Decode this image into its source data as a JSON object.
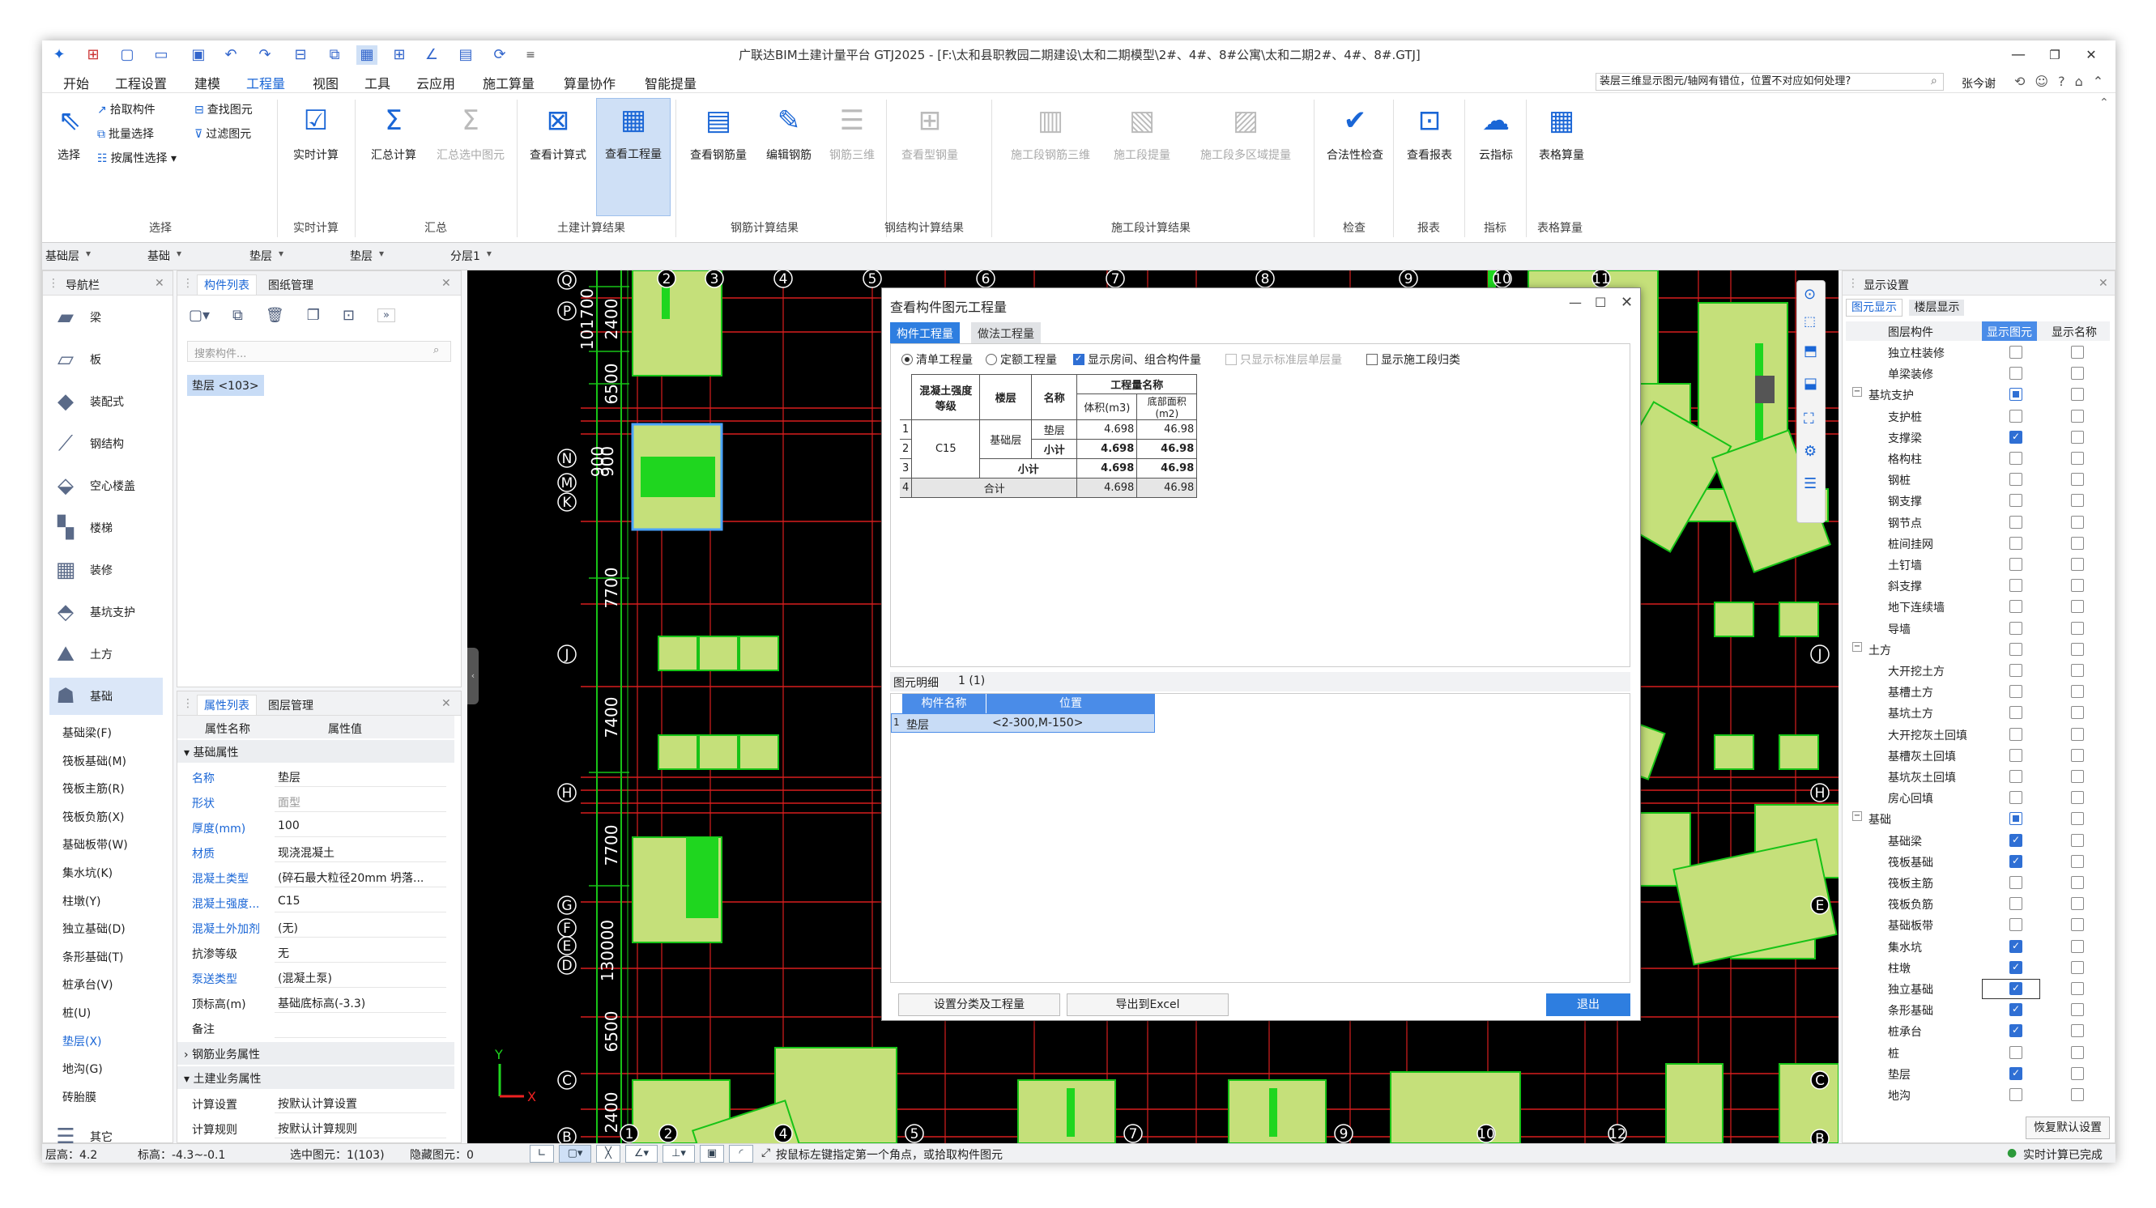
{
  "window": {
    "title": "广联达BIM土建计量平台 GTJ2025 - [F:\\太和县职教园二期建设\\太和二期模型\\2#、4#、8#公寓\\太和二期2#、4#、8#.GTJ]",
    "min_label": "—",
    "restore_label": "❐",
    "close_label": "✕"
  },
  "menu": {
    "items": [
      "开始",
      "工程设置",
      "建模",
      "工程量",
      "视图",
      "工具",
      "云应用",
      "施工算量",
      "算量协作",
      "智能提量"
    ],
    "active": "工程量",
    "question": "装层三维显示图元/轴网有错位，位置不对应如何处理?",
    "user": "张今谢"
  },
  "ribbon": {
    "groups": [
      {
        "name": "选择",
        "big": [
          "选择"
        ],
        "small": [
          "拾取构件",
          "批量选择",
          "按属性选择",
          "查找图元",
          "过滤图元"
        ]
      },
      {
        "name": "实时计算",
        "big": [
          "实时计算"
        ]
      },
      {
        "name": "汇总",
        "big": [
          "汇总计算",
          "汇总选中图元"
        ]
      },
      {
        "name": "土建计算结果",
        "big": [
          "查看计算式",
          "查看工程量"
        ]
      },
      {
        "name": "钢筋计算结果",
        "big": [
          "查看钢筋量",
          "编辑钢筋",
          "钢筋三维"
        ]
      },
      {
        "name": "钢结构计算结果",
        "big": [
          "查看型钢量"
        ]
      },
      {
        "name": "施工段计算结果",
        "big": [
          "施工段钢筋三维",
          "施工段提量",
          "施工段多区域提量"
        ]
      },
      {
        "name": "检查",
        "big": [
          "合法性检查"
        ]
      },
      {
        "name": "报表",
        "big": [
          "查看报表"
        ]
      },
      {
        "name": "指标",
        "big": [
          "云指标"
        ]
      },
      {
        "name": "表格算量",
        "big": [
          "表格算量"
        ]
      }
    ]
  },
  "floorbar": {
    "selects": [
      "基础层",
      "基础",
      "垫层",
      "垫层",
      "分层1"
    ]
  },
  "nav": {
    "title": "导航栏",
    "items": [
      "梁",
      "板",
      "装配式",
      "钢结构",
      "空心楼盖",
      "楼梯",
      "装修",
      "基坑支护",
      "土方",
      "基础"
    ],
    "sub_items": [
      "基础梁(F)",
      "筏板基础(M)",
      "筏板主筋(R)",
      "筏板负筋(X)",
      "基础板带(W)",
      "集水坑(K)",
      "柱墩(Y)",
      "独立基础(D)",
      "条形基础(T)",
      "桩承台(V)",
      "桩(U)",
      "垫层(X)",
      "地沟(G)",
      "砖胎膜"
    ],
    "other": "其它"
  },
  "component_list": {
    "tabs": [
      "构件列表",
      "图纸管理"
    ],
    "search_placeholder": "搜索构件...",
    "items": [
      "垫层 <103>"
    ]
  },
  "properties": {
    "tabs": [
      "属性列表",
      "图层管理"
    ],
    "col_name": "属性名称",
    "col_value": "属性值",
    "section1": "基础属性",
    "rows": [
      {
        "n": "名称",
        "v": "垫层"
      },
      {
        "n": "形状",
        "v": "面型"
      },
      {
        "n": "厚度(mm)",
        "v": "100"
      },
      {
        "n": "材质",
        "v": "现浇混凝土"
      },
      {
        "n": "混凝土类型",
        "v": "(碎石最大粒径20mm 坍落..."
      },
      {
        "n": "混凝土强度...",
        "v": "C15"
      },
      {
        "n": "混凝土外加剂",
        "v": "(无)"
      },
      {
        "n": "抗渗等级",
        "v": "无"
      },
      {
        "n": "泵送类型",
        "v": "(混凝土泵)"
      },
      {
        "n": "顶标高(m)",
        "v": "基础底标高(-3.3)"
      },
      {
        "n": "备注",
        "v": ""
      }
    ],
    "section2": "钢筋业务属性",
    "section3": "土建业务属性",
    "rows2": [
      {
        "n": "计算设置",
        "v": "按默认计算设置"
      },
      {
        "n": "计算规则",
        "v": "按默认计算规则"
      }
    ]
  },
  "axes": {
    "left_letters": [
      "Q",
      "P",
      "N",
      "M",
      "K",
      "J",
      "H",
      "G",
      "F",
      "E",
      "D",
      "C",
      "B"
    ],
    "top_numbers": [
      "2",
      "3",
      "4",
      "5",
      "6",
      "7",
      "8",
      "9",
      "10",
      "11"
    ],
    "bottom_numbers": [
      "1",
      "2",
      "4",
      "5",
      "7",
      "9",
      "10",
      "12"
    ],
    "dims": [
      "101700",
      "2400",
      "6500",
      "900",
      "900",
      "7700",
      "7400",
      "7700",
      "130000",
      "6500",
      "2400"
    ],
    "right_letters": [
      "J",
      "H",
      "E",
      "C",
      "B"
    ]
  },
  "dialog": {
    "title": "查看构件图元工程量",
    "tabs": [
      "构件工程量",
      "做法工程量"
    ],
    "options": [
      "清单工程量",
      "定额工程量",
      "显示房间、组合构件量",
      "只显示标准层单层量",
      "显示施工段归类"
    ],
    "table": {
      "header": [
        "混凝土强度等级",
        "楼层",
        "名称",
        "工程量名称",
        "体积(m3)",
        "底部面积(m2)"
      ],
      "rows": [
        [
          "1",
          "C15",
          "基础层",
          "垫层",
          "4.698",
          "46.98"
        ],
        [
          "2",
          "",
          "",
          "小计",
          "4.698",
          "46.98"
        ],
        [
          "3",
          "",
          "小计",
          "",
          "4.698",
          "46.98"
        ],
        [
          "4",
          "合计",
          "",
          "",
          "4.698",
          "46.98"
        ]
      ]
    },
    "detail_title": "图元明细",
    "detail_count": "1 (1)",
    "detail_headers": [
      "构件名称",
      "位置"
    ],
    "detail_rows": [
      {
        "idx": "1",
        "name": "垫层",
        "pos": "<2-300,M-150>"
      }
    ],
    "buttons": [
      "设置分类及工程量",
      "导出到Excel",
      "退出"
    ]
  },
  "display_settings": {
    "title": "显示设置",
    "tabs": [
      "图元显示",
      "楼层显示"
    ],
    "headers": [
      "图层构件",
      "显示图元",
      "显示名称"
    ],
    "rows": [
      {
        "label": "独立柱装修",
        "level": 1,
        "show": false,
        "name": false
      },
      {
        "label": "单梁装修",
        "level": 1,
        "show": false,
        "name": false
      },
      {
        "label": "基坑支护",
        "level": 0,
        "show": "part",
        "name": false
      },
      {
        "label": "支护桩",
        "level": 1,
        "show": false,
        "name": false
      },
      {
        "label": "支撑梁",
        "level": 1,
        "show": true,
        "name": false
      },
      {
        "label": "格构柱",
        "level": 1,
        "show": false,
        "name": false
      },
      {
        "label": "钢桩",
        "level": 1,
        "show": false,
        "name": false
      },
      {
        "label": "钢支撑",
        "level": 1,
        "show": false,
        "name": false
      },
      {
        "label": "钢节点",
        "level": 1,
        "show": false,
        "name": false
      },
      {
        "label": "桩间挂网",
        "level": 1,
        "show": false,
        "name": false
      },
      {
        "label": "土钉墙",
        "level": 1,
        "show": false,
        "name": false
      },
      {
        "label": "斜支撑",
        "level": 1,
        "show": false,
        "name": false
      },
      {
        "label": "地下连续墙",
        "level": 1,
        "show": false,
        "name": false
      },
      {
        "label": "导墙",
        "level": 1,
        "show": false,
        "name": false
      },
      {
        "label": "土方",
        "level": 0,
        "show": false,
        "name": false
      },
      {
        "label": "大开挖土方",
        "level": 1,
        "show": false,
        "name": false
      },
      {
        "label": "基槽土方",
        "level": 1,
        "show": false,
        "name": false
      },
      {
        "label": "基坑土方",
        "level": 1,
        "show": false,
        "name": false
      },
      {
        "label": "大开挖灰土回填",
        "level": 1,
        "show": false,
        "name": false
      },
      {
        "label": "基槽灰土回填",
        "level": 1,
        "show": false,
        "name": false
      },
      {
        "label": "基坑灰土回填",
        "level": 1,
        "show": false,
        "name": false
      },
      {
        "label": "房心回填",
        "level": 1,
        "show": false,
        "name": false
      },
      {
        "label": "基础",
        "level": 0,
        "show": "part",
        "name": false
      },
      {
        "label": "基础梁",
        "level": 1,
        "show": true,
        "name": false
      },
      {
        "label": "筏板基础",
        "level": 1,
        "show": true,
        "name": false
      },
      {
        "label": "筏板主筋",
        "level": 1,
        "show": false,
        "name": false
      },
      {
        "label": "筏板负筋",
        "level": 1,
        "show": false,
        "name": false
      },
      {
        "label": "基础板带",
        "level": 1,
        "show": false,
        "name": false
      },
      {
        "label": "集水坑",
        "level": 1,
        "show": true,
        "name": false
      },
      {
        "label": "柱墩",
        "level": 1,
        "show": true,
        "name": false
      },
      {
        "label": "独立基础",
        "level": 1,
        "show": true,
        "name": false
      },
      {
        "label": "条形基础",
        "level": 1,
        "show": true,
        "name": false
      },
      {
        "label": "桩承台",
        "level": 1,
        "show": true,
        "name": false
      },
      {
        "label": "桩",
        "level": 1,
        "show": false,
        "name": false
      },
      {
        "label": "垫层",
        "level": 1,
        "show": true,
        "name": false
      },
      {
        "label": "地沟",
        "level": 1,
        "show": false,
        "name": false
      }
    ],
    "reset_button": "恢复默认设置"
  },
  "status": {
    "floor_height": "层高：4.2",
    "elevation": "标高：-4.3~-0.1",
    "selected": "选中图元：1(103)",
    "hidden": "隐藏图元：0",
    "hint": "按鼠标左键指定第一个角点，或拾取构件图元",
    "calc": "实时计算已完成"
  },
  "colors": {
    "accent": "#1a66d6",
    "footing_fill": "#c5e07a",
    "footing_edge": "#17c317",
    "grid_red": "#d81e1e",
    "canvas_bg": "#000000"
  }
}
